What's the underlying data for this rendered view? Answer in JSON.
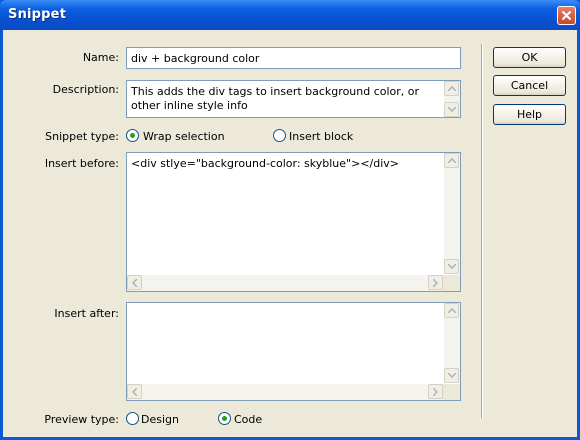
{
  "window": {
    "title": "Snippet"
  },
  "form": {
    "name_label": "Name:",
    "name_value": "div + background color",
    "description_label": "Description:",
    "description_value": "This adds the div tags to insert background color, or other inline style info",
    "snippet_type_label": "Snippet type:",
    "snippet_type_options": [
      "Wrap selection",
      "Insert block"
    ],
    "snippet_type_selected": "Wrap selection",
    "insert_before_label": "Insert before:",
    "insert_before_value": "<div stlye=\"background-color: skyblue\"></div>",
    "insert_after_label": "Insert after:",
    "insert_after_value": "",
    "preview_type_label": "Preview type:",
    "preview_type_options": [
      "Design",
      "Code"
    ],
    "preview_type_selected": "Code"
  },
  "buttons": {
    "ok": "OK",
    "cancel": "Cancel",
    "help": "Help"
  },
  "colors": {
    "titlebar": "#0b5fe0",
    "client_bg": "#ece9d8",
    "radio_dot": "#21a121",
    "input_border": "#7f9db9"
  },
  "icons": {
    "close": "close-icon",
    "scroll_up": "arrow-up-icon",
    "scroll_down": "arrow-down-icon",
    "scroll_left": "arrow-left-icon",
    "scroll_right": "arrow-right-icon"
  }
}
